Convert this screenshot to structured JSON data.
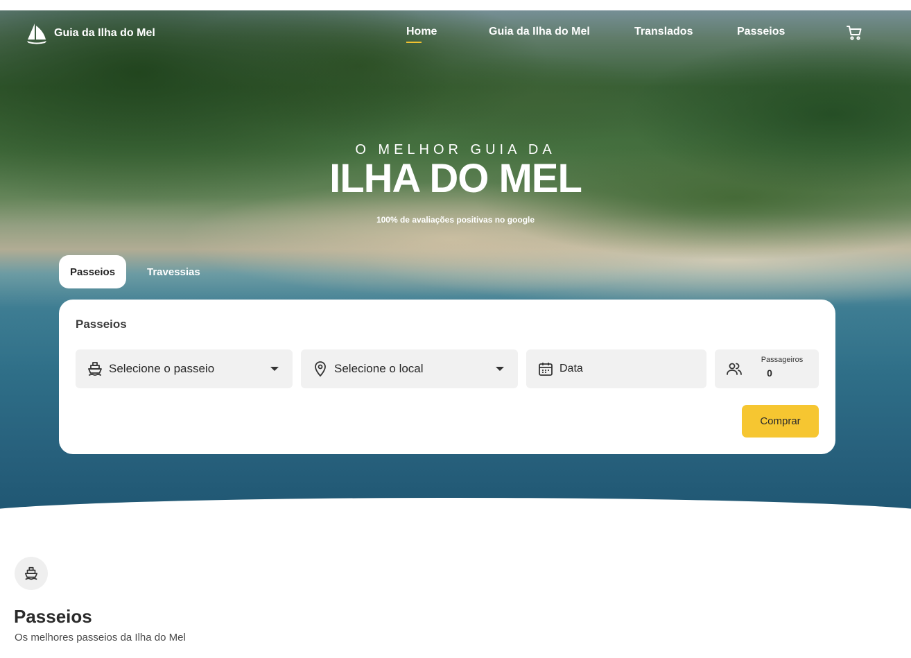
{
  "header": {
    "brand": "Guia da Ilha do Mel",
    "nav": [
      {
        "label": "Home",
        "active": true
      },
      {
        "label": "Guia da Ilha do Mel",
        "active": false
      },
      {
        "label": "Translados",
        "active": false
      },
      {
        "label": "Passeios",
        "active": false
      }
    ],
    "cart_icon": "cart-icon",
    "accent_color": "#f2c230"
  },
  "hero": {
    "eyebrow": "O MELHOR GUIA DA",
    "title": "ILHA DO MEL",
    "subtitle": "100% de avaliações positivas no google"
  },
  "tabs": [
    {
      "label": "Passeios",
      "active": true
    },
    {
      "label": "Travessias",
      "active": false
    }
  ],
  "search": {
    "title": "Passeios",
    "tour_select": {
      "placeholder": "Selecione o passeio",
      "icon": "boat-icon"
    },
    "location_select": {
      "placeholder": "Selecione o local",
      "icon": "location-pin-icon"
    },
    "date": {
      "placeholder": "Data",
      "icon": "calendar-icon"
    },
    "passengers": {
      "label": "Passageiros",
      "value": "0",
      "icon": "people-icon"
    },
    "buy_label": "Comprar",
    "buy_color": "#f6c631"
  },
  "section": {
    "icon": "boat-icon",
    "title": "Passeios",
    "subtitle": "Os melhores passeios da Ilha do Mel"
  }
}
